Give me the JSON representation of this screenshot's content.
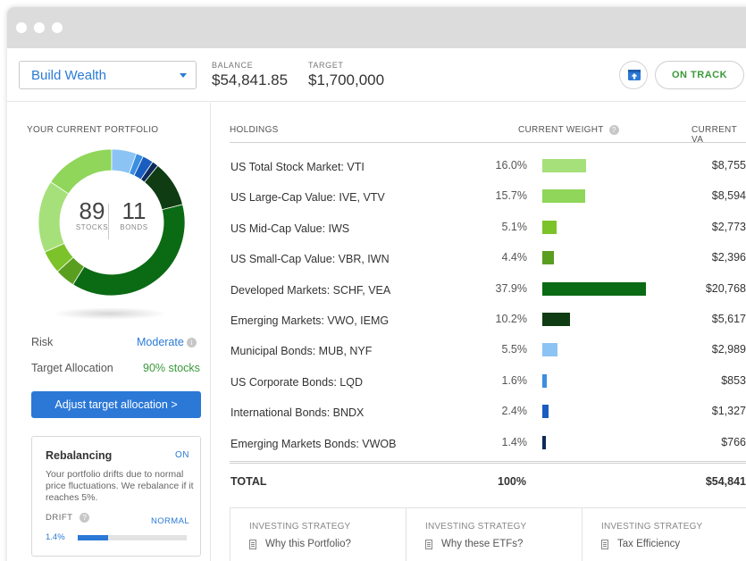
{
  "goal_select": {
    "value": "Build Wealth"
  },
  "balance": {
    "label": "BALANCE",
    "value": "$54,841.85"
  },
  "target": {
    "label": "TARGET",
    "value": "$1,700,000"
  },
  "status": {
    "label": "ON TRACK"
  },
  "portfolio": {
    "title": "YOUR CURRENT PORTFOLIO",
    "stocks_value": "89",
    "stocks_label": "STOCKS",
    "bonds_value": "11",
    "bonds_label": "BONDS",
    "risk_label": "Risk",
    "risk_value": "Moderate",
    "allocation_label": "Target Allocation",
    "allocation_value": "90% stocks",
    "adjust_button": "Adjust target allocation >"
  },
  "rebalancing": {
    "title": "Rebalancing",
    "state": "ON",
    "description": "Your portfolio drifts due to normal price fluctuations. We rebalance if it reaches 5%.",
    "drift_label": "DRIFT",
    "drift_status": "NORMAL",
    "drift_value": "1.4%",
    "drift_fraction": 0.28
  },
  "holdings": {
    "col_holdings": "HOLDINGS",
    "col_weight": "CURRENT WEIGHT",
    "col_value": "CURRENT VA",
    "rows": [
      {
        "name": "US Total Stock Market: VTI",
        "pct": "16.0%",
        "weight": 16.0,
        "color": "#a6e07a",
        "value": "$8,755"
      },
      {
        "name": "US Large-Cap Value: IVE, VTV",
        "pct": "15.7%",
        "weight": 15.7,
        "color": "#8fd65a",
        "value": "$8,594"
      },
      {
        "name": "US Mid-Cap Value: IWS",
        "pct": "5.1%",
        "weight": 5.1,
        "color": "#7cc22a",
        "value": "$2,773"
      },
      {
        "name": "US Small-Cap Value: VBR, IWN",
        "pct": "4.4%",
        "weight": 4.4,
        "color": "#5a9e20",
        "value": "$2,396"
      },
      {
        "name": "Developed Markets: SCHF, VEA",
        "pct": "37.9%",
        "weight": 37.9,
        "color": "#0b6a14",
        "value": "$20,768"
      },
      {
        "name": "Emerging Markets: VWO, IEMG",
        "pct": "10.2%",
        "weight": 10.2,
        "color": "#0f3c12",
        "value": "$5,617"
      },
      {
        "name": "Municipal Bonds: MUB, NYF",
        "pct": "5.5%",
        "weight": 5.5,
        "color": "#8cc3f5",
        "value": "$2,989"
      },
      {
        "name": "US Corporate Bonds: LQD",
        "pct": "1.6%",
        "weight": 1.6,
        "color": "#3a8fe0",
        "value": "$853"
      },
      {
        "name": "International Bonds: BNDX",
        "pct": "2.4%",
        "weight": 2.4,
        "color": "#1a5dc0",
        "value": "$1,327"
      },
      {
        "name": "Emerging Markets Bonds: VWOB",
        "pct": "1.4%",
        "weight": 1.4,
        "color": "#0d2a5a",
        "value": "$766"
      }
    ],
    "total_label": "TOTAL",
    "total_pct": "100%",
    "total_value": "$54,841"
  },
  "strategies": [
    {
      "kicker": "INVESTING STRATEGY",
      "title": "Why this Portfolio?"
    },
    {
      "kicker": "INVESTING STRATEGY",
      "title": "Why these ETFs?"
    },
    {
      "kicker": "INVESTING STRATEGY",
      "title": "Tax Efficiency"
    }
  ]
}
